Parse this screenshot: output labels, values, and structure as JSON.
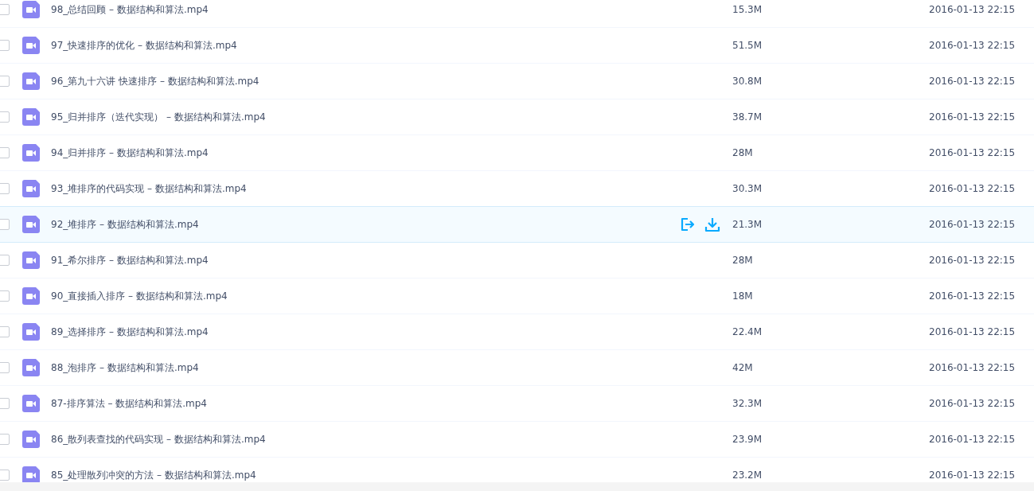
{
  "files": [
    {
      "name": "98_总结回顾 – 数据结构和算法.mp4",
      "size": "15.3M",
      "date": "2016-01-13 22:15",
      "checked": false,
      "hovered": false
    },
    {
      "name": "97_快速排序的优化 – 数据结构和算法.mp4",
      "size": "51.5M",
      "date": "2016-01-13 22:15",
      "checked": false,
      "hovered": false
    },
    {
      "name": "96_第九十六讲 快速排序 – 数据结构和算法.mp4",
      "size": "30.8M",
      "date": "2016-01-13 22:15",
      "checked": false,
      "hovered": false
    },
    {
      "name": "95_归并排序（迭代实现） – 数据结构和算法.mp4",
      "size": "38.7M",
      "date": "2016-01-13 22:15",
      "checked": false,
      "hovered": false
    },
    {
      "name": "94_归并排序 – 数据结构和算法.mp4",
      "size": "28M",
      "date": "2016-01-13 22:15",
      "checked": false,
      "hovered": false
    },
    {
      "name": "93_堆排序的代码实现 – 数据结构和算法.mp4",
      "size": "30.3M",
      "date": "2016-01-13 22:15",
      "checked": false,
      "hovered": false
    },
    {
      "name": "92_堆排序 – 数据结构和算法.mp4",
      "size": "21.3M",
      "date": "2016-01-13 22:15",
      "checked": false,
      "hovered": true
    },
    {
      "name": "91_希尔排序 – 数据结构和算法.mp4",
      "size": "28M",
      "date": "2016-01-13 22:15",
      "checked": false,
      "hovered": false
    },
    {
      "name": "90_直接插入排序 – 数据结构和算法.mp4",
      "size": "18M",
      "date": "2016-01-13 22:15",
      "checked": false,
      "hovered": false
    },
    {
      "name": "89_选择排序 – 数据结构和算法.mp4",
      "size": "22.4M",
      "date": "2016-01-13 22:15",
      "checked": false,
      "hovered": false
    },
    {
      "name": "88_泡排序 – 数据结构和算法.mp4",
      "size": "42M",
      "date": "2016-01-13 22:15",
      "checked": false,
      "hovered": false
    },
    {
      "name": "87-排序算法 – 数据结构和算法.mp4",
      "size": "32.3M",
      "date": "2016-01-13 22:15",
      "checked": false,
      "hovered": false
    },
    {
      "name": "86_散列表查找的代码实现 – 数据结构和算法.mp4",
      "size": "23.9M",
      "date": "2016-01-13 22:15",
      "checked": false,
      "hovered": false
    },
    {
      "name": "85_处理散列冲突的方法 – 数据结构和算法.mp4",
      "size": "23.2M",
      "date": "2016-01-13 22:15",
      "checked": false,
      "hovered": false
    }
  ]
}
